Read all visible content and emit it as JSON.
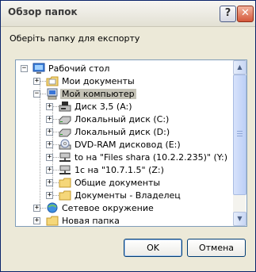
{
  "window": {
    "title": "Обзор папок"
  },
  "title_buttons": {
    "help_label": "?",
    "close_label": "✕"
  },
  "dialog": {
    "prompt": "Оберіть папку для експорту"
  },
  "tree": {
    "items": [
      {
        "label": "Рабочий стол",
        "icon": "desktop-icon",
        "expander": "−",
        "selected": false
      },
      {
        "label": "Мои документы",
        "icon": "documents-folder-icon",
        "expander": "+",
        "selected": false
      },
      {
        "label": "Мой компьютер",
        "icon": "computer-icon",
        "expander": "−",
        "selected": true
      },
      {
        "label": "Диск 3,5 (A:)",
        "icon": "floppy-drive-icon",
        "expander": "+",
        "selected": false
      },
      {
        "label": "Локальный диск (C:)",
        "icon": "hard-drive-icon",
        "expander": "+",
        "selected": false
      },
      {
        "label": "Локальный диск (D:)",
        "icon": "hard-drive-icon",
        "expander": "+",
        "selected": false
      },
      {
        "label": "DVD-RAM дисковод (E:)",
        "icon": "dvd-drive-icon",
        "expander": "+",
        "selected": false
      },
      {
        "label": "to на \"Files shara (10.2.2.235)\" (Y:)",
        "icon": "network-drive-icon",
        "expander": "+",
        "selected": false
      },
      {
        "label": "1c на \"10.7.1.5\" (Z:)",
        "icon": "network-drive-icon",
        "expander": "+",
        "selected": false
      },
      {
        "label": "Общие документы",
        "icon": "shared-folder-icon",
        "expander": "+",
        "selected": false
      },
      {
        "label": "Документы - Владелец",
        "icon": "folder-icon",
        "expander": "+",
        "selected": false
      },
      {
        "label": "Сетевое окружение",
        "icon": "network-places-icon",
        "expander": "+",
        "selected": false
      },
      {
        "label": "Новая папка",
        "icon": "folder-icon",
        "expander": "+",
        "selected": false
      }
    ]
  },
  "scrollbar": {
    "up_arrow": "▲",
    "down_arrow": "▼"
  },
  "buttons": {
    "ok": "OK",
    "cancel": "Отмена"
  }
}
